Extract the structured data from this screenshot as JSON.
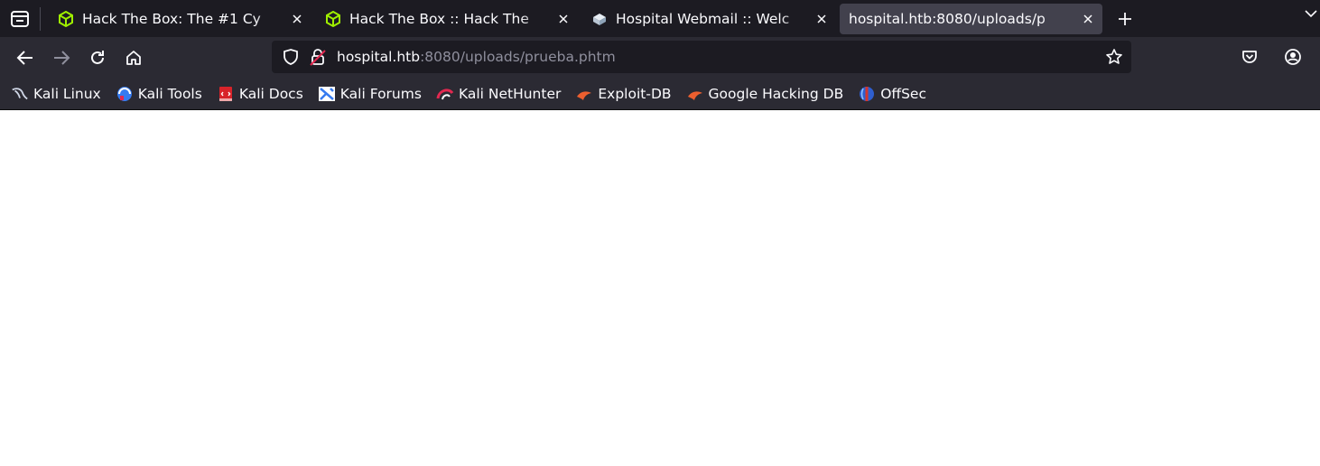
{
  "tabs": [
    {
      "title": "Hack The Box: The #1 Cy",
      "icon": "htb-cube-icon",
      "active": false
    },
    {
      "title": "Hack The Box :: Hack The",
      "icon": "htb-cube-icon",
      "active": false
    },
    {
      "title": "Hospital Webmail :: Welc",
      "icon": "roundcube-icon",
      "active": false
    },
    {
      "title": "hospital.htb:8080/uploads/p",
      "icon": "none",
      "active": true
    }
  ],
  "urlbar": {
    "domain": "hospital.htb",
    "rest": ":8080/uploads/prueba.phtm"
  },
  "bookmarks": [
    {
      "label": "Kali Linux",
      "icon": "kali-dragon-icon"
    },
    {
      "label": "Kali Tools",
      "icon": "kali-tools-icon"
    },
    {
      "label": "Kali Docs",
      "icon": "kali-docs-icon"
    },
    {
      "label": "Kali Forums",
      "icon": "kali-forums-icon"
    },
    {
      "label": "Kali NetHunter",
      "icon": "nethunter-icon"
    },
    {
      "label": "Exploit-DB",
      "icon": "exploit-db-icon"
    },
    {
      "label": "Google Hacking DB",
      "icon": "ghdb-icon"
    },
    {
      "label": "OffSec",
      "icon": "offsec-icon"
    }
  ],
  "colors": {
    "tabstrip_bg": "#1c1b22",
    "toolbar_bg": "#2b2a33",
    "active_tab_bg": "#42414d",
    "htb_green": "#9fef00"
  }
}
